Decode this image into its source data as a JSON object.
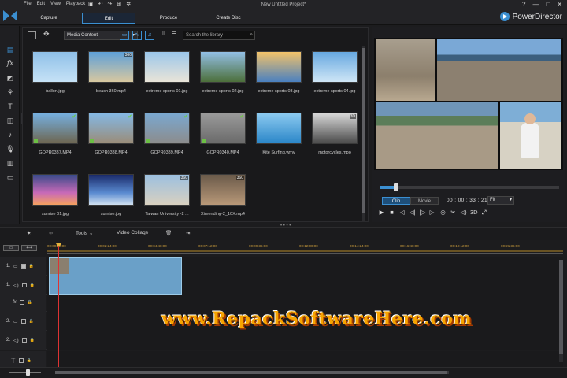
{
  "menu": [
    "File",
    "Edit",
    "View",
    "Playback"
  ],
  "project_title": "New Untitled Project*",
  "modes": [
    "Capture",
    "Edit",
    "Produce",
    "Create Disc"
  ],
  "active_mode": "Edit",
  "brand": "PowerDirector",
  "window_controls": [
    "?",
    "—",
    "□",
    "✕"
  ],
  "library": {
    "content_select": "Media Content",
    "search_placeholder": "Search the library",
    "items": [
      {
        "name": "ballon.jpg",
        "badge": "",
        "check": false
      },
      {
        "name": "beach 360.mp4",
        "badge": "360",
        "check": false
      },
      {
        "name": "extreme sports 01.jpg",
        "badge": "",
        "check": false
      },
      {
        "name": "extreme sports 02.jpg",
        "badge": "",
        "check": false
      },
      {
        "name": "extreme sports 03.jpg",
        "badge": "",
        "check": false
      },
      {
        "name": "extreme sports 04.jpg",
        "badge": "",
        "check": false
      },
      {
        "name": "GOPR0337.MP4",
        "badge": "",
        "check": true
      },
      {
        "name": "GOPR0338.MP4",
        "badge": "",
        "check": true
      },
      {
        "name": "GOPR0339.MP4",
        "badge": "",
        "check": true
      },
      {
        "name": "GOPR0340.MP4",
        "badge": "",
        "check": true
      },
      {
        "name": "Kite Surfing.wmv",
        "badge": "",
        "check": false
      },
      {
        "name": "motorcycles.mpo",
        "badge": "3D",
        "check": false
      },
      {
        "name": "sunrise 01.jpg",
        "badge": "",
        "check": false
      },
      {
        "name": "sunrise.jpg",
        "badge": "",
        "check": false
      },
      {
        "name": "Taiwan University -2 ...",
        "badge": "360",
        "check": false
      },
      {
        "name": "Ximending-2_10X.mp4",
        "badge": "360",
        "check": false
      }
    ]
  },
  "preview": {
    "clip_label": "Clip",
    "movie_label": "Movie",
    "timecode": "00 : 00 : 33 : 21",
    "fit": "Fit",
    "progress": 0.09,
    "controls": [
      "▶",
      "■",
      "◁",
      "◁|",
      "|▷",
      "▷|",
      "◎",
      "✂",
      "◁)",
      "3D",
      "⤢"
    ]
  },
  "timeline_toolbar": {
    "tools_label": "Tools",
    "video_collage_label": "Video Collage"
  },
  "ruler_ticks": [
    "00:00:00:00",
    "00:02:24:00",
    "00:04:48:00",
    "00:07:12:00",
    "00:09:36:00",
    "00:12:00:00",
    "00:14:24:00",
    "00:16:48:00",
    "00:19:12:00",
    "00:21:36:00"
  ],
  "tracks": [
    {
      "label": "1.",
      "type": "video"
    },
    {
      "label": "1.",
      "type": "audio"
    },
    {
      "label": "fx",
      "type": "fx"
    },
    {
      "label": "2.",
      "type": "video"
    },
    {
      "label": "2.",
      "type": "audio"
    },
    {
      "label": "T",
      "type": "title"
    }
  ],
  "watermark": "www.RepackSoftwareHere.com",
  "colors": {
    "accent": "#3b8fd1",
    "watermark": "#f6a400",
    "clip": "#6aa0c8",
    "playhead": "#dd3333"
  }
}
